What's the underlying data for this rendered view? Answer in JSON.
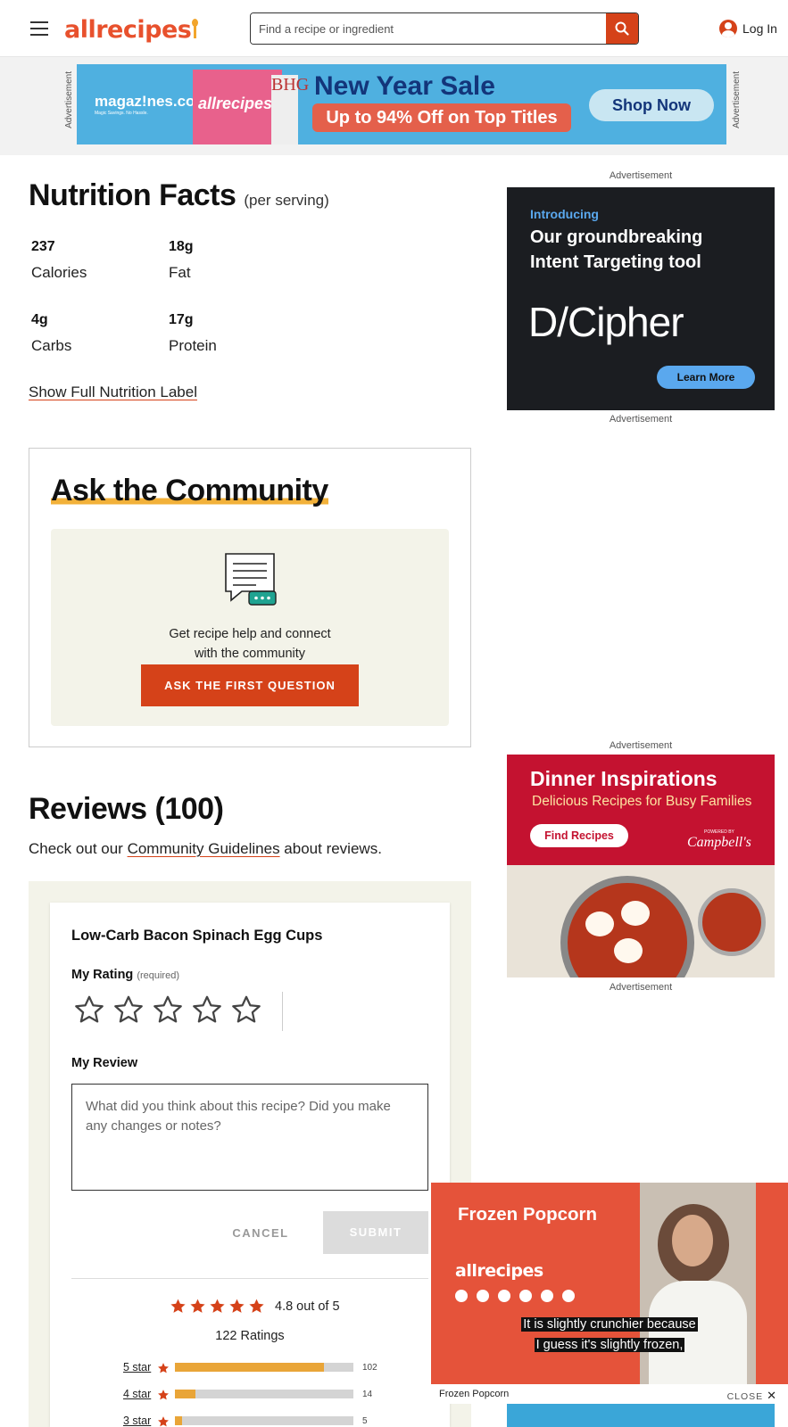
{
  "header": {
    "logo_text": "allrecipes",
    "search_placeholder": "Find a recipe or ingredient",
    "login_label": "Log In"
  },
  "top_ad": {
    "side_label": "Advertisement",
    "brand": "magaz!nes.com",
    "brand_tagline": "Magic Savings. No Hassle.",
    "cover_title": "allrecipes",
    "cover_side": "BHG",
    "headline": "New Year Sale",
    "subline": "Up to 94% Off on Top Titles",
    "cta": "Shop Now"
  },
  "nutrition": {
    "title": "Nutrition Facts",
    "per": "(per serving)",
    "items": [
      {
        "value": "237",
        "label": "Calories"
      },
      {
        "value": "18g",
        "label": "Fat"
      },
      {
        "value": "4g",
        "label": "Carbs"
      },
      {
        "value": "17g",
        "label": "Protein"
      }
    ],
    "show_full": "Show Full Nutrition Label"
  },
  "community": {
    "title": "Ask the Community",
    "text_line1": "Get recipe help and connect",
    "text_line2": "with the community",
    "button": "ASK THE FIRST QUESTION"
  },
  "reviews": {
    "title": "Reviews (100)",
    "guide_prefix": "Check out our ",
    "guide_link": "Community Guidelines",
    "guide_suffix": " about reviews.",
    "card": {
      "recipe_name": "Low-Carb Bacon Spinach Egg Cups",
      "my_rating": "My Rating",
      "required": "(required)",
      "my_review": "My Review",
      "review_placeholder": "What did you think about this recipe? Did you make any changes or notes?",
      "cancel": "CANCEL",
      "submit": "SUBMIT",
      "average_text": "4.8 out of 5",
      "ratings_count": "122 Ratings",
      "breakdown": [
        {
          "label": "5 star",
          "count": "102",
          "fraction": 0.836
        },
        {
          "label": "4 star",
          "count": "14",
          "fraction": 0.115
        },
        {
          "label": "3 star",
          "count": "5",
          "fraction": 0.041
        }
      ]
    }
  },
  "right_ads": {
    "label": "Advertisement",
    "dcipher": {
      "intro": "Introducing",
      "headline1": "Our groundbreaking",
      "headline2": "Intent Targeting tool",
      "brand": "D/Cipher",
      "cta": "Learn More"
    },
    "campbell": {
      "headline": "Dinner Inspirations",
      "subline": "Delicious Recipes for Busy Families",
      "cta": "Find Recipes",
      "brand": "Campbell's",
      "powered": "POWERED BY"
    }
  },
  "video": {
    "title": "Frozen Popcorn",
    "logo": "allrecipes",
    "caption_line1": "It is slightly crunchier because",
    "caption_line2": "I guess it's slightly frozen,",
    "bar_title": "Frozen Popcorn",
    "close": "CLOSE"
  },
  "colors": {
    "brand_orange": "#d54219",
    "rating_gold": "#e9a538",
    "community_bg": "#f3f3e9"
  }
}
